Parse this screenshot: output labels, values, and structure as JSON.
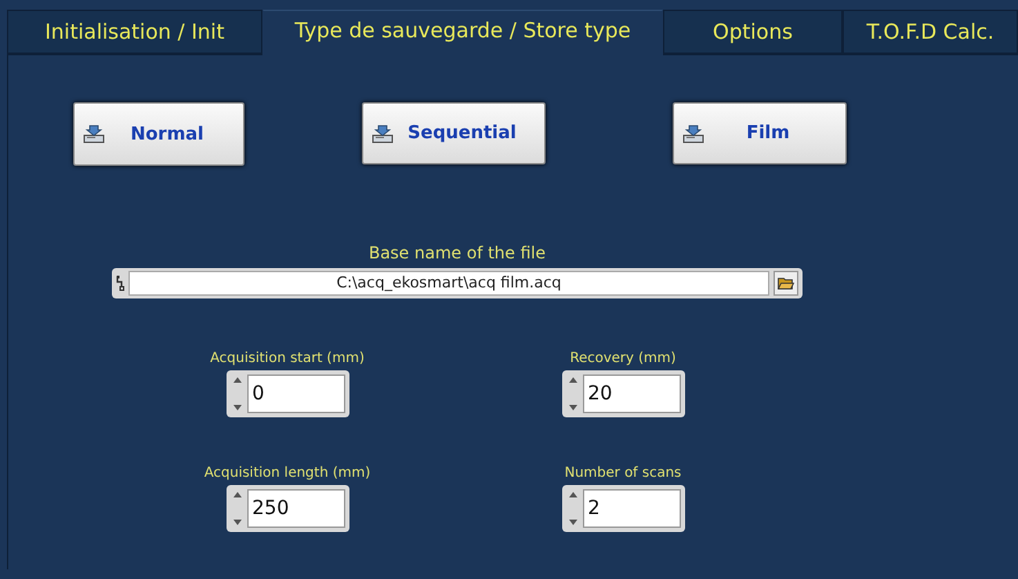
{
  "tabs": [
    {
      "label": "Initialisation / Init",
      "selected": false
    },
    {
      "label": "Type de sauvegarde / Store type",
      "selected": true
    },
    {
      "label": "Options",
      "selected": false
    },
    {
      "label": "T.O.F.D Calc.",
      "selected": false
    }
  ],
  "store_buttons": [
    {
      "label": "Normal"
    },
    {
      "label": "Sequential"
    },
    {
      "label": "Film"
    }
  ],
  "file": {
    "label": "Base name of the file",
    "value": "C:\\acq_ekosmart\\acq film.acq"
  },
  "numeric_fields": [
    {
      "label": "Acquisition start (mm)",
      "value": "0"
    },
    {
      "label": "Recovery (mm)",
      "value": "20"
    },
    {
      "label": "Acquisition length (mm)",
      "value": "250"
    },
    {
      "label": "Number of scans",
      "value": "2"
    }
  ]
}
